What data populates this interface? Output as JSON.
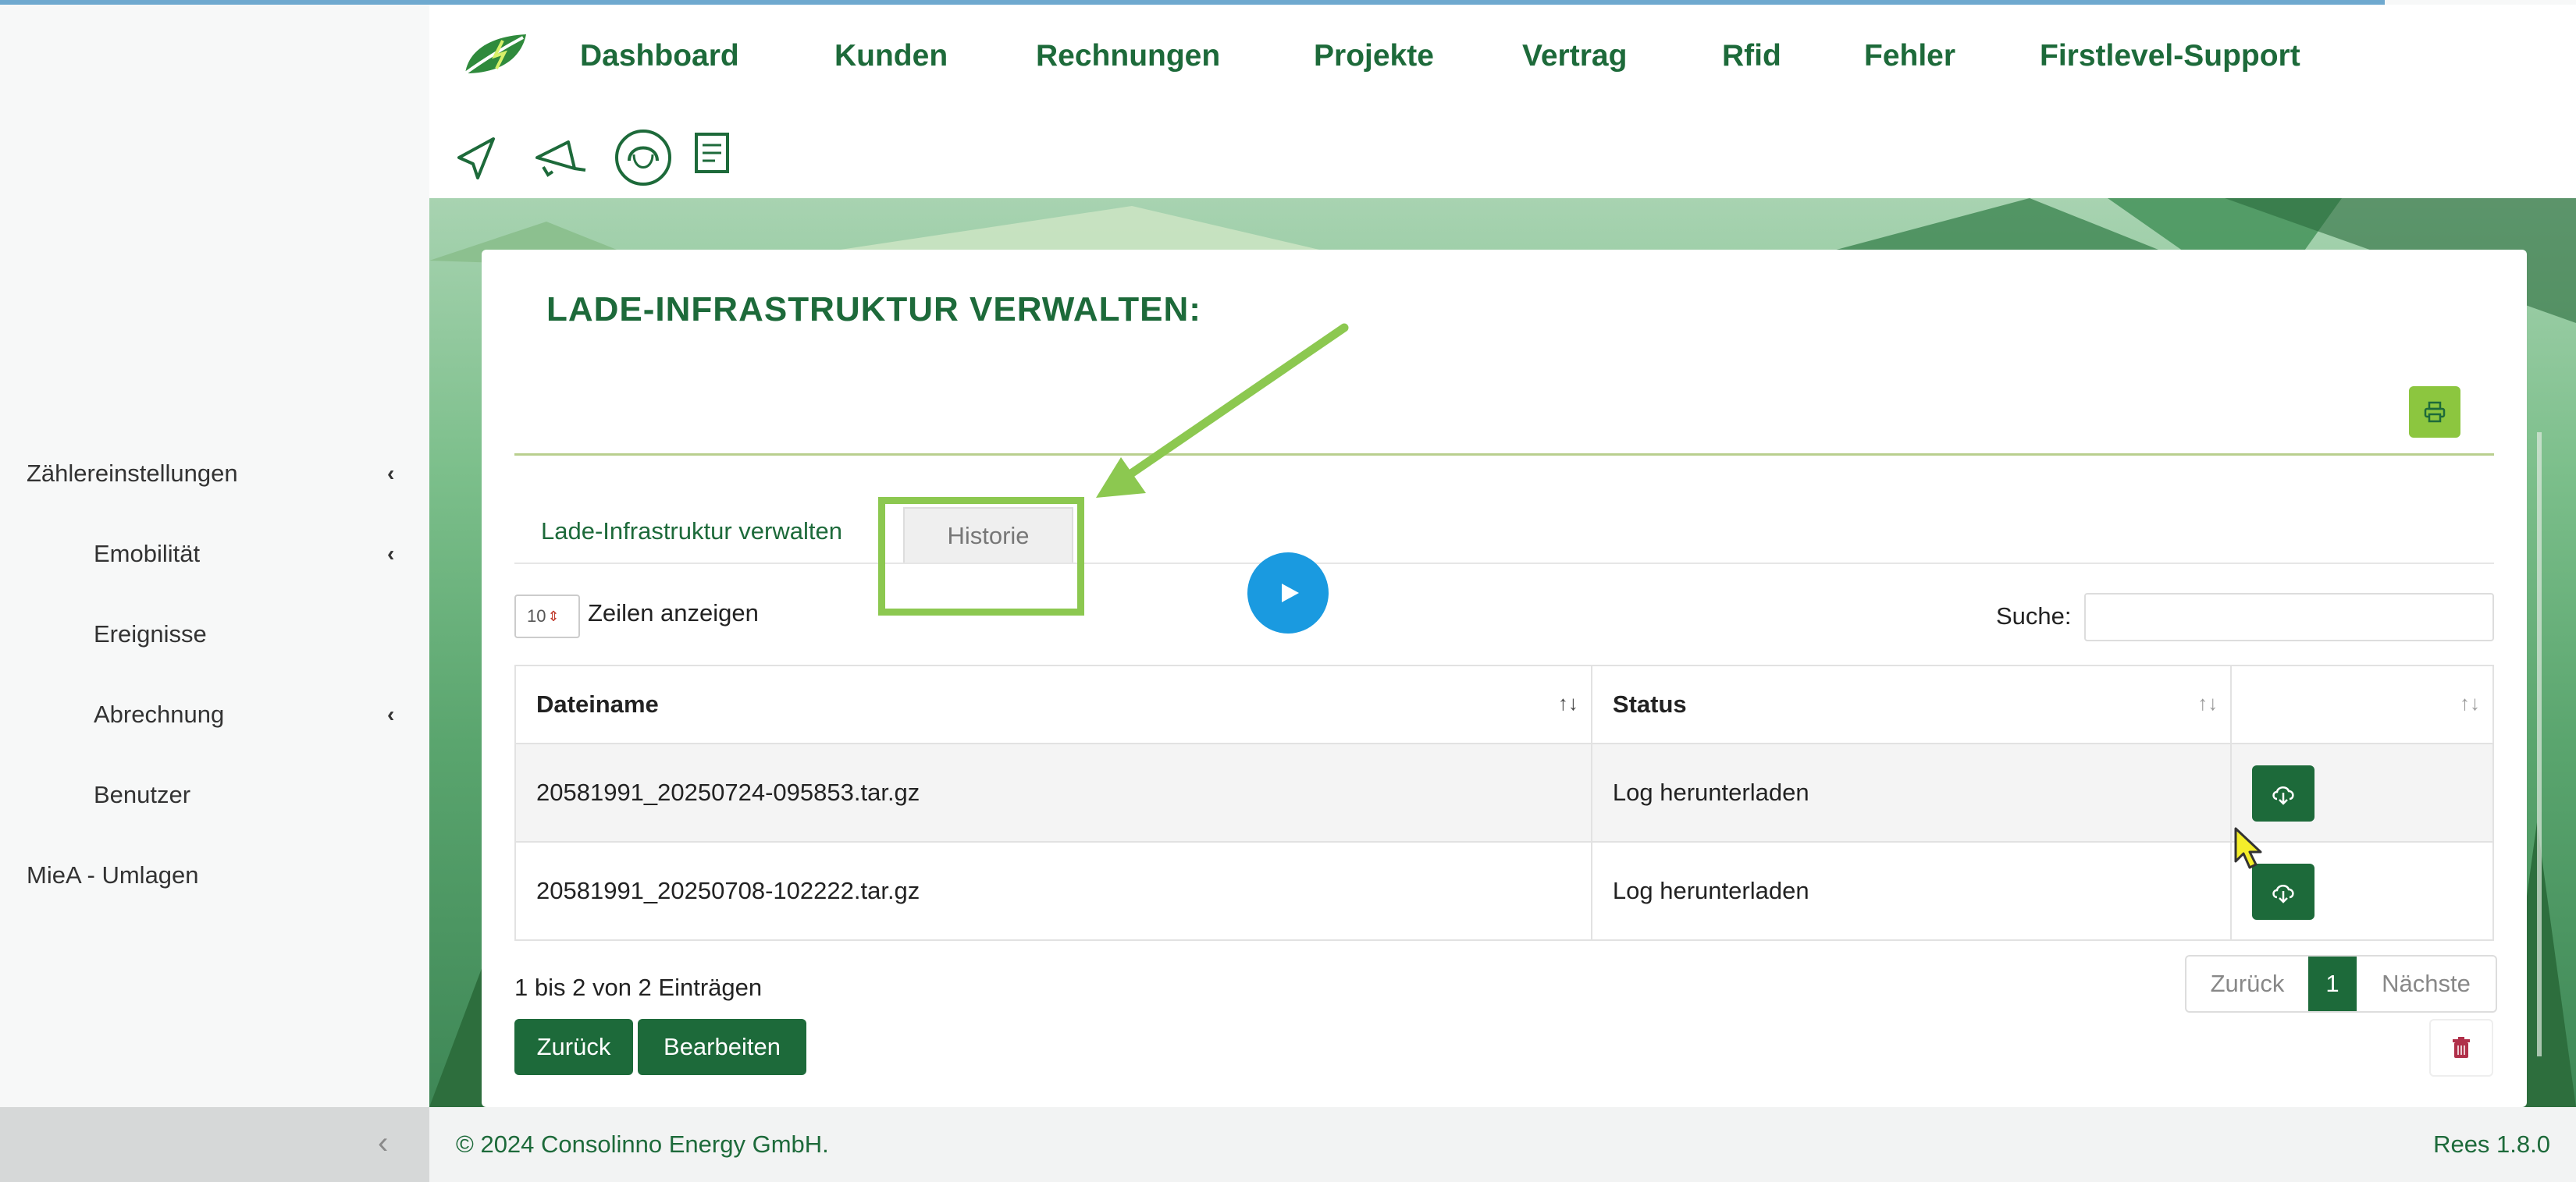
{
  "nav": {
    "items": [
      "Dashboard",
      "Kunden",
      "Rechnungen",
      "Projekte",
      "Vertrag",
      "Rfid",
      "Fehler",
      "Firstlevel-Support"
    ]
  },
  "toolbar_icons": [
    "send-icon",
    "megaphone-icon",
    "support-headset-icon",
    "invoice-icon"
  ],
  "sidebar": {
    "items": [
      {
        "label": "Zählereinstellungen",
        "has_chevron": true
      },
      {
        "label": "Emobilität",
        "has_chevron": true
      },
      {
        "label": "Ereignisse",
        "has_chevron": false
      },
      {
        "label": "Abrechnung",
        "has_chevron": true
      },
      {
        "label": "Benutzer",
        "has_chevron": false
      },
      {
        "label": "MieA - Umlagen",
        "has_chevron": false
      }
    ],
    "chevron": "‹",
    "collapse_chevron": "‹"
  },
  "card": {
    "title": "LADE-INFRASTRUKTUR VERWALTEN:",
    "tabs": [
      "Lade-Infrastruktur verwalten",
      "Historie"
    ],
    "length_value": "10",
    "length_label": "Zeilen anzeigen",
    "search_label": "Suche:",
    "search_value": ""
  },
  "table": {
    "columns": [
      "Dateiname",
      "Status",
      ""
    ],
    "rows": [
      {
        "filename": "20581991_20250724-095853.tar.gz",
        "status": "Log herunterladen"
      },
      {
        "filename": "20581991_20250708-102222.tar.gz",
        "status": "Log herunterladen"
      }
    ],
    "sort_indicators": [
      "↑↓",
      "↑↓",
      "↑↓"
    ]
  },
  "pagination": {
    "info": "1 bis 2 von 2 Einträgen",
    "prev": "Zurück",
    "current": "1",
    "next": "Nächste"
  },
  "actions": {
    "back": "Zurück",
    "edit": "Bearbeiten"
  },
  "footer": {
    "copyright": "© 2024 Consolinno Energy GmbH.",
    "version": "Rees 1.8.0"
  },
  "colors": {
    "brand_green": "#1d6a3a",
    "accent_green": "#8cc63f",
    "annotation_green": "#8cc850",
    "play_blue": "#1a9ae0"
  }
}
